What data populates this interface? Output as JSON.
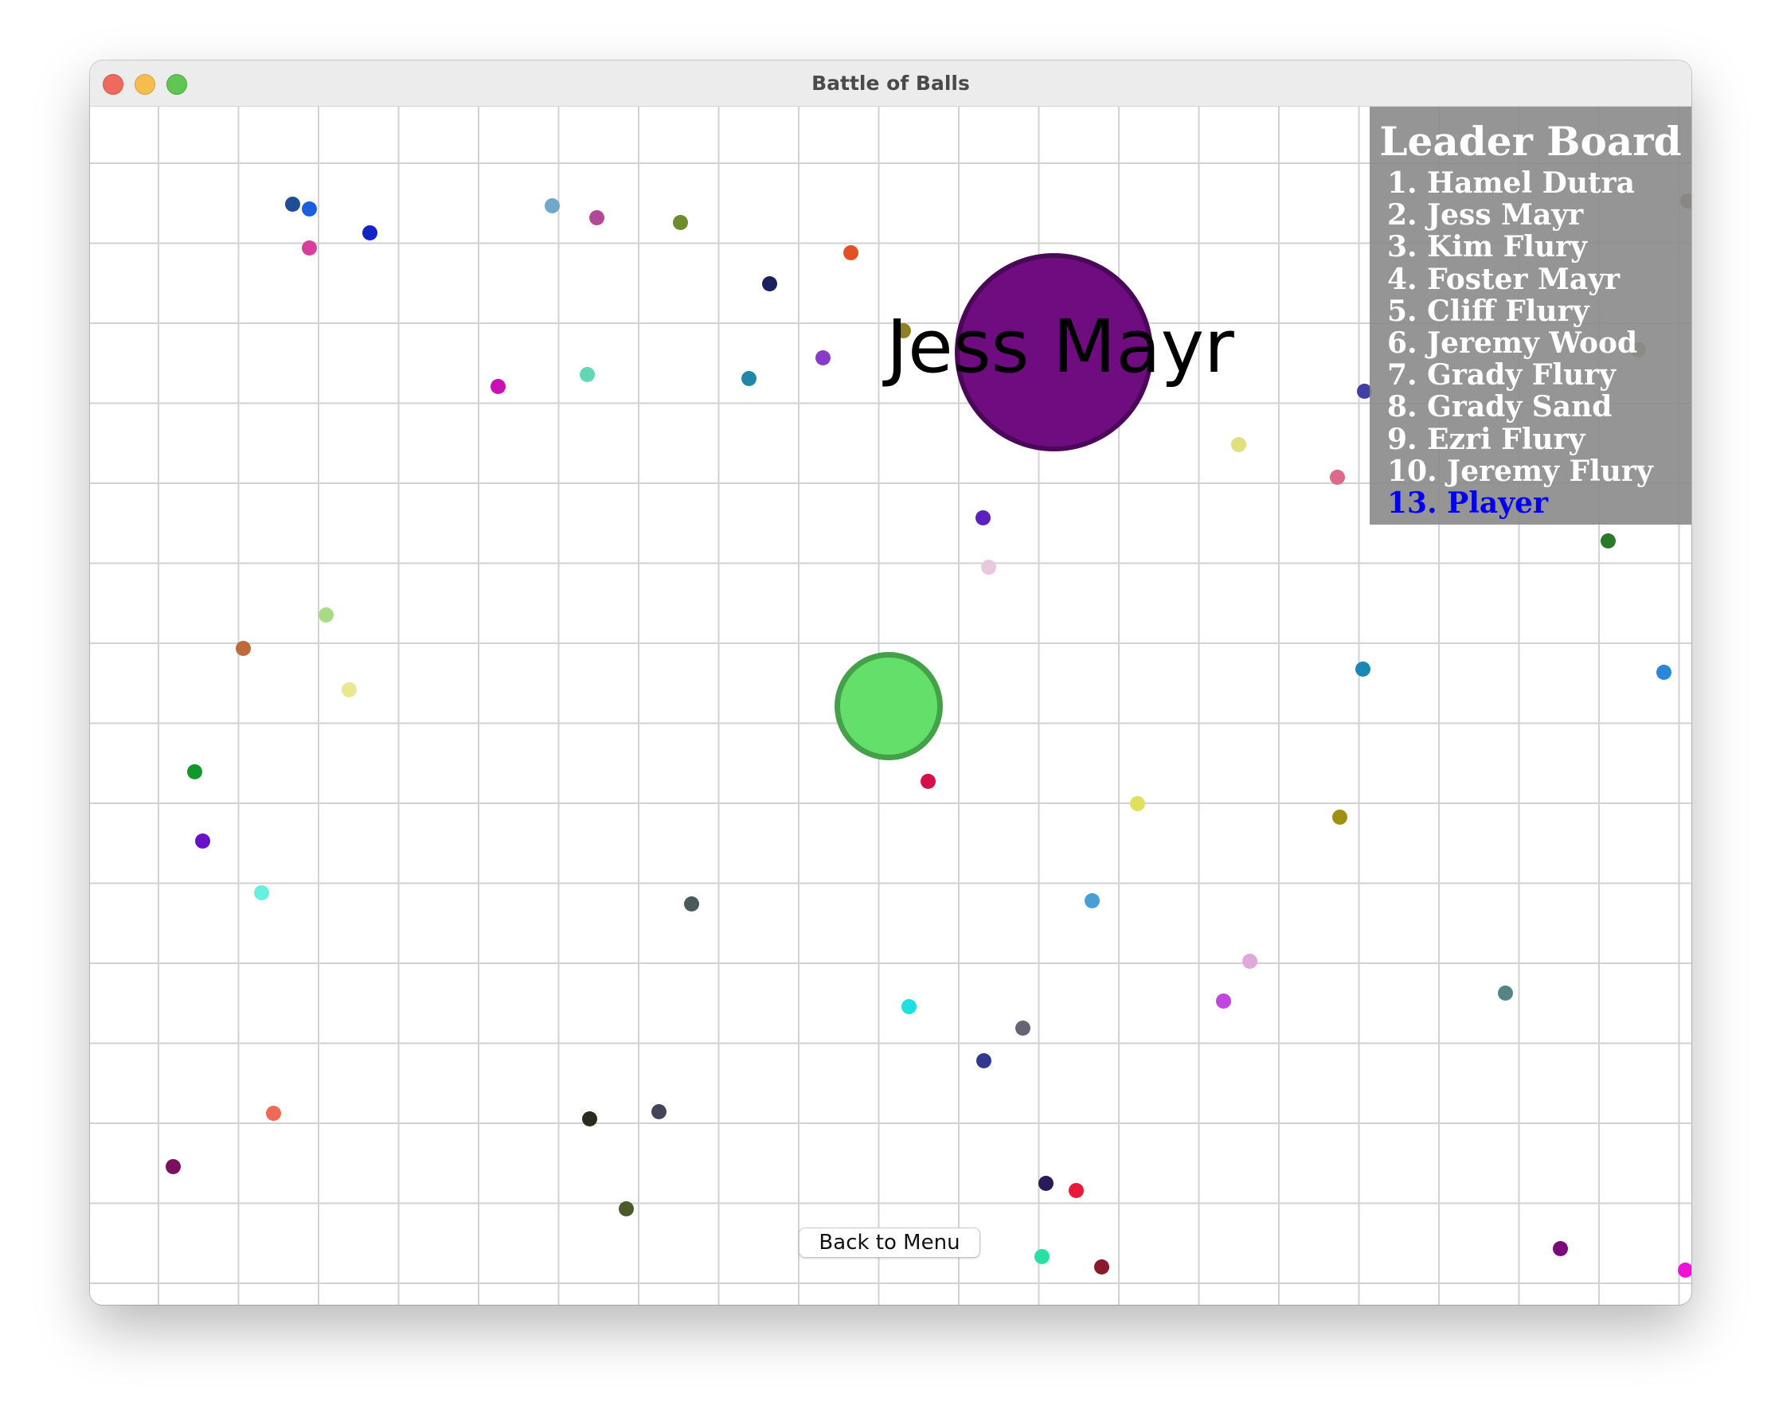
{
  "window": {
    "title": "Battle of Balls"
  },
  "game": {
    "enemy_name": "Jess Mayr",
    "enemy_color": "#6e0c80",
    "player_color": "#64e06a"
  },
  "leaderboard": {
    "title": "Leader Board",
    "entries": [
      "1. Hamel Dutra",
      "2. Jess Mayr",
      "3. Kim Flury",
      "4. Foster Mayr",
      "5. Cliff Flury",
      "6. Jeremy Wood",
      "7. Grady Flury",
      "8. Grady Sand",
      "9. Ezri Flury",
      "10. Jeremy Flury"
    ],
    "player_entry": "13. Player",
    "player_entry_color": "#0000ee"
  },
  "controls": {
    "back_label": "Back to Menu"
  }
}
